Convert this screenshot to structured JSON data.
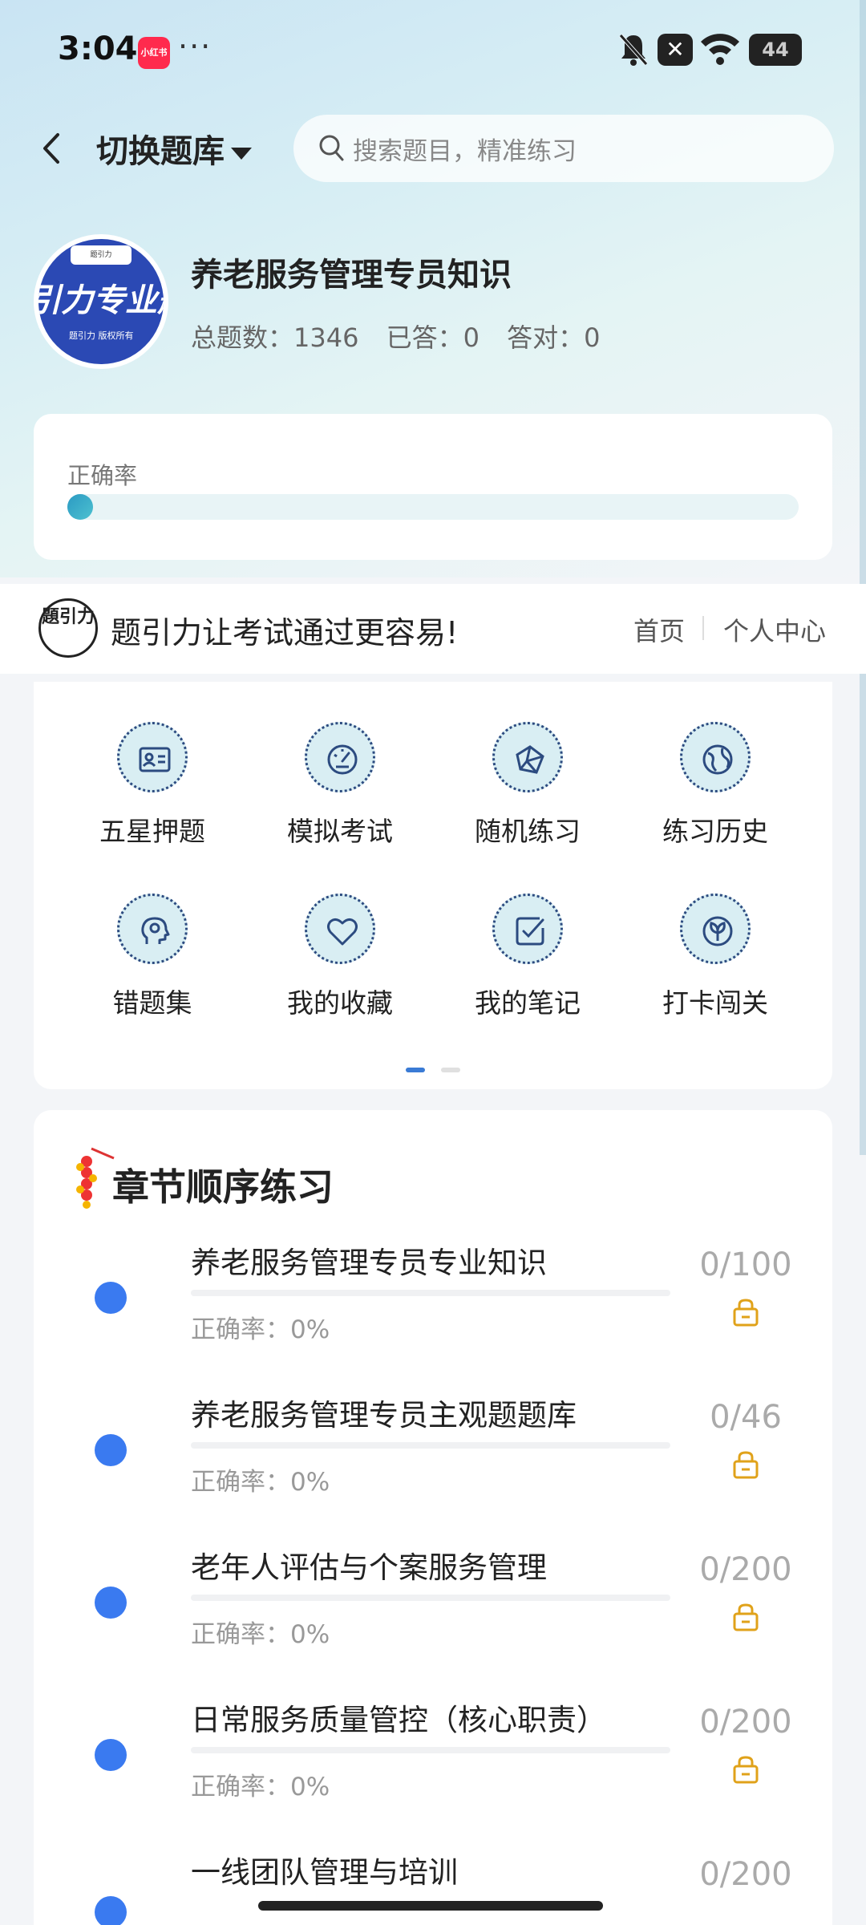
{
  "status_bar": {
    "time": "3:04",
    "app_badge": "小红书",
    "more": "···",
    "battery": "44"
  },
  "header": {
    "switch_label": "切换题库",
    "search_placeholder": "搜索题目，精准练习"
  },
  "profile": {
    "avatar_top": "题引力",
    "avatar_big": "引力专业题",
    "avatar_small": "题引力 版权所有",
    "title": "养老服务管理专员知识",
    "total_label": "总题数：1346",
    "answered_label": "已答：0",
    "correct_label": "答对：0"
  },
  "accuracy": {
    "label": "正确率",
    "value": 0
  },
  "brand": {
    "logo_text": "題引力",
    "slogan": "题引力让考试通过更容易!",
    "nav_home": "首页",
    "nav_me": "个人中心"
  },
  "features": [
    {
      "label": "五星押题",
      "icon": "id-card-icon"
    },
    {
      "label": "模拟考试",
      "icon": "gauge-icon"
    },
    {
      "label": "随机练习",
      "icon": "network-icon"
    },
    {
      "label": "练习历史",
      "icon": "globe-icon"
    },
    {
      "label": "错题集",
      "icon": "head-icon"
    },
    {
      "label": "我的收藏",
      "icon": "heart-icon"
    },
    {
      "label": "我的笔记",
      "icon": "note-check-icon"
    },
    {
      "label": "打卡闯关",
      "icon": "leaf-icon"
    }
  ],
  "chapters": {
    "title": "章节顺序练习",
    "items": [
      {
        "name": "养老服务管理专员专业知识",
        "rate": "正确率：0%",
        "count": "0/100"
      },
      {
        "name": "养老服务管理专员主观题题库",
        "rate": "正确率：0%",
        "count": "0/46"
      },
      {
        "name": "老年人评估与个案服务管理",
        "rate": "正确率：0%",
        "count": "0/200"
      },
      {
        "name": "日常服务质量管控（核心职责）",
        "rate": "正确率：0%",
        "count": "0/200"
      },
      {
        "name": "一线团队管理与培训",
        "rate": "",
        "count": "0/200"
      }
    ]
  },
  "colors": {
    "accent": "#3a7af0",
    "lock": "#e0a21a"
  }
}
